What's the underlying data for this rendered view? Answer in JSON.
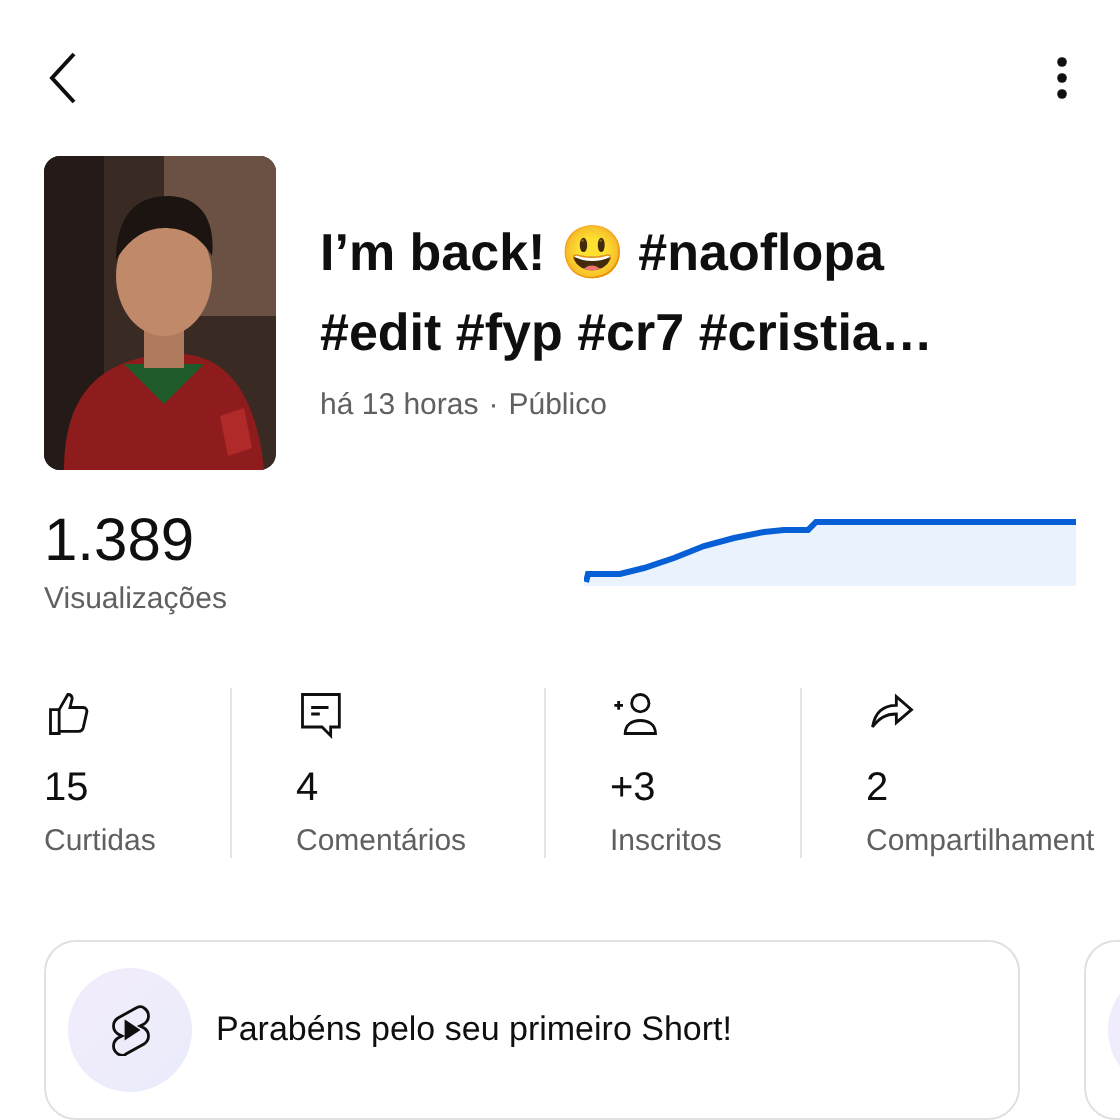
{
  "video": {
    "title_lines": [
      "I’m back! 😃 #naoflopa",
      "#edit #fyp #cr7 #cristia…"
    ],
    "age": "há 13 horas",
    "separator": "·",
    "visibility": "Público"
  },
  "views": {
    "value": "1.389",
    "label": "Visualizações"
  },
  "stats": [
    {
      "kind": "likes",
      "value": "15",
      "label": "Curtidas"
    },
    {
      "kind": "comments",
      "value": "4",
      "label": "Comentários"
    },
    {
      "kind": "subscribers",
      "value": "+3",
      "label": "Inscritos"
    },
    {
      "kind": "shares",
      "value": "2",
      "label": "Compartilhament"
    }
  ],
  "cards": [
    {
      "kind": "shorts",
      "text": "Parabéns pelo seu primeiro Short!"
    },
    {
      "kind": "partial"
    }
  ]
}
